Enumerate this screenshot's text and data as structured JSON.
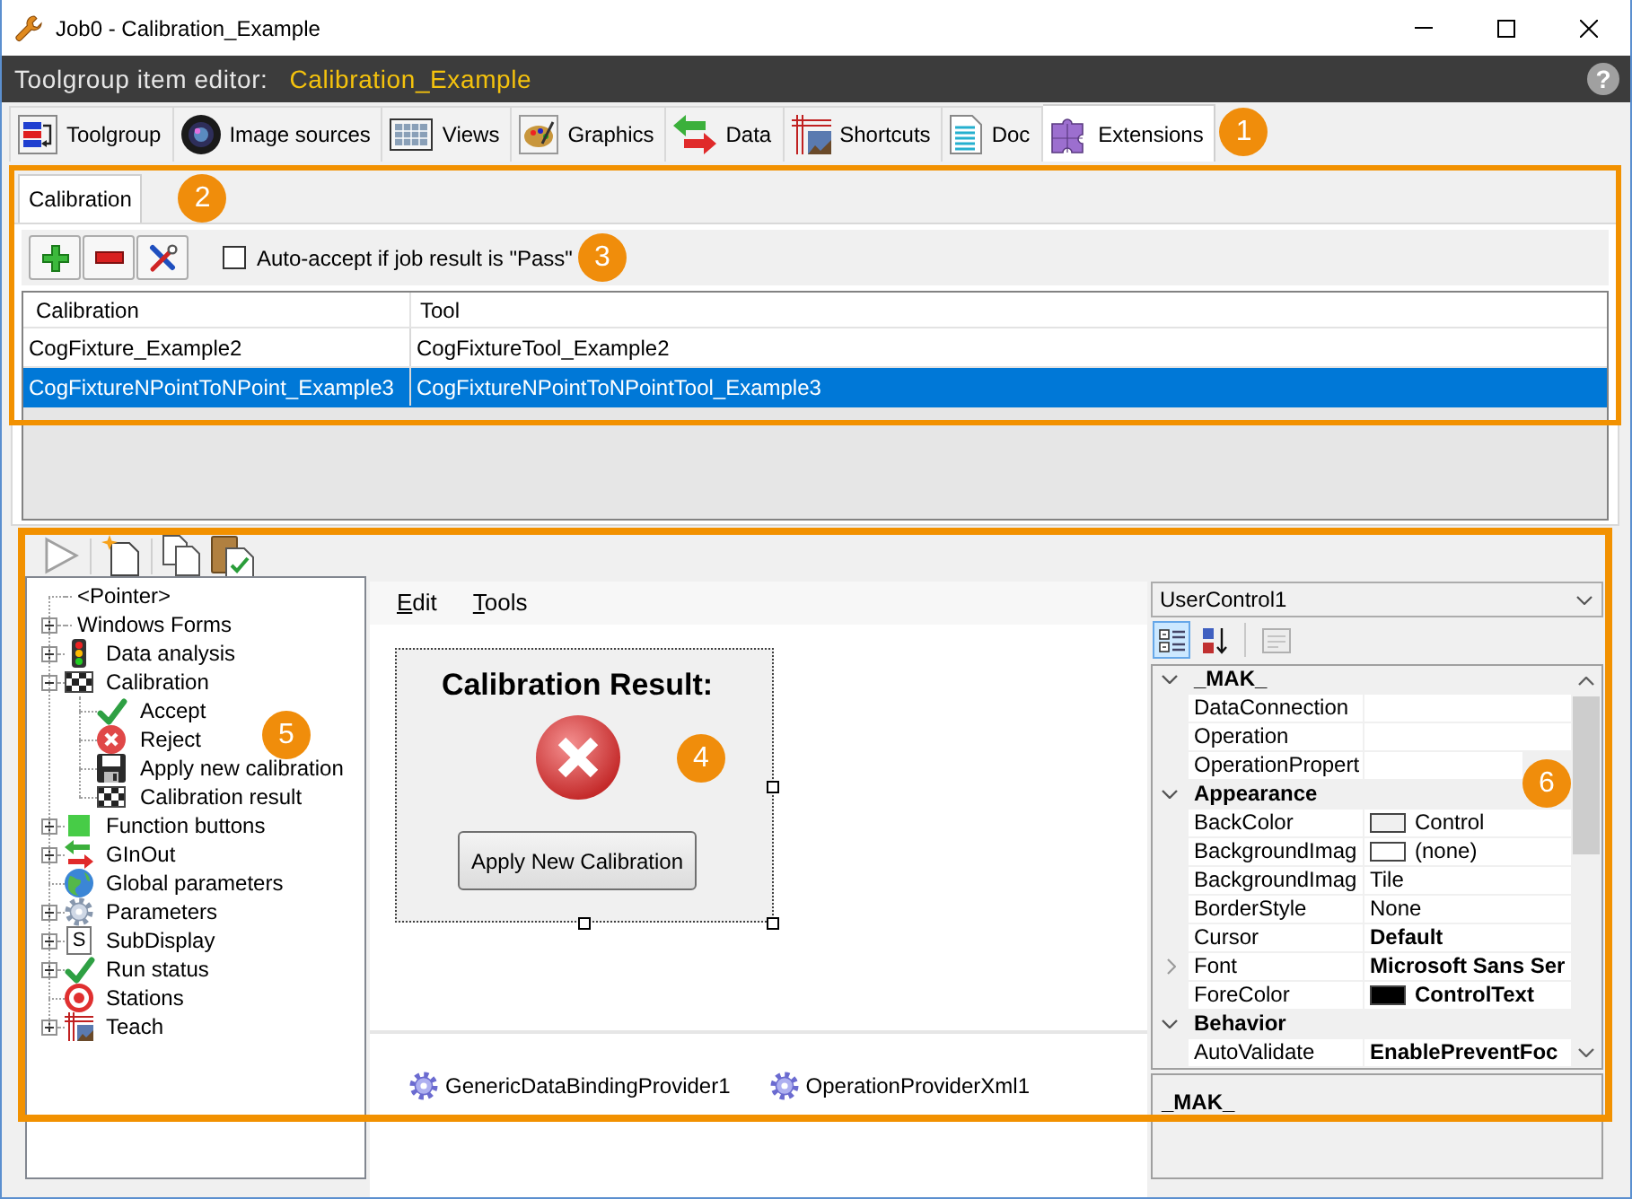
{
  "window": {
    "title": "Job0 - Calibration_Example"
  },
  "editor_header": {
    "label": "Toolgroup item editor:",
    "item_name": "Calibration_Example",
    "help": "?"
  },
  "main_tabs": {
    "items": [
      {
        "kind": "toolgroup",
        "label": "Toolgroup",
        "selected": false
      },
      {
        "kind": "image_sources",
        "label": "Image sources",
        "selected": false
      },
      {
        "kind": "views",
        "label": "Views",
        "selected": false
      },
      {
        "kind": "graphics",
        "label": "Graphics",
        "selected": false
      },
      {
        "kind": "data",
        "label": "Data",
        "selected": false
      },
      {
        "kind": "shortcuts",
        "label": "Shortcuts",
        "selected": false
      },
      {
        "kind": "doc",
        "label": "Doc",
        "selected": false
      },
      {
        "kind": "extensions",
        "label": "Extensions",
        "selected": true
      }
    ],
    "callout": "1"
  },
  "extension_tabs": {
    "items": [
      {
        "label": "Calibration",
        "selected": true
      }
    ],
    "callout": "2"
  },
  "auto_accept": {
    "label": "Auto-accept if job result is \"Pass\"",
    "checked": false,
    "callout": "3"
  },
  "calibration_table": {
    "columns": [
      "Calibration",
      "Tool"
    ],
    "rows": [
      {
        "cells": [
          "CogFixture_Example2",
          "CogFixtureTool_Example2"
        ],
        "selected": false
      },
      {
        "cells": [
          "CogFixtureNPointToNPoint_Example3",
          "CogFixtureNPointToNPointTool_Example3"
        ],
        "selected": true
      }
    ]
  },
  "toolbox": {
    "callout": "5",
    "items": [
      {
        "label": "<Pointer>"
      },
      {
        "label": "Windows Forms",
        "expanded": false
      },
      {
        "kind": "traffic_light",
        "label": "Data analysis",
        "expanded": false
      },
      {
        "kind": "checker",
        "label": "Calibration",
        "expanded": true,
        "children": [
          {
            "kind": "check",
            "label": "Accept"
          },
          {
            "kind": "error",
            "label": "Reject"
          },
          {
            "kind": "floppy",
            "label": "Apply new calibration"
          },
          {
            "kind": "checker",
            "label": "Calibration result"
          }
        ]
      },
      {
        "kind": "square",
        "label": "Function buttons",
        "expanded": false
      },
      {
        "kind": "arrows",
        "label": "GInOut",
        "expanded": false
      },
      {
        "kind": "globe",
        "label": "Global parameters"
      },
      {
        "kind": "gear",
        "label": "Parameters",
        "expanded": false
      },
      {
        "kind": "letter_box",
        "icon_text": "S",
        "label": "SubDisplay",
        "expanded": false
      },
      {
        "kind": "check",
        "label": "Run status",
        "expanded": false
      },
      {
        "kind": "target",
        "label": "Stations"
      },
      {
        "kind": "teach",
        "label": "Teach",
        "expanded": false
      }
    ]
  },
  "designer": {
    "menu": [
      {
        "label": "Edit",
        "mnemonic": true
      },
      {
        "label": "Tools",
        "mnemonic": true
      }
    ],
    "user_control": {
      "title": "Calibration Result:",
      "button": "Apply New Calibration",
      "selected": true,
      "callout": "4"
    },
    "components": [
      "GenericDataBindingProvider1",
      "OperationProviderXml1"
    ]
  },
  "properties": {
    "object": "UserControl1",
    "sort_modes": [
      {
        "kind": "categorized",
        "selected": true
      },
      {
        "kind": "alphabetical",
        "selected": false
      }
    ],
    "property_pages": {
      "disabled": true
    },
    "callout": "6",
    "categories": [
      {
        "name": "_MAK_",
        "expanded": true,
        "items": [
          {
            "kind": "text",
            "name": "DataConnection"
          },
          {
            "kind": "text",
            "name": "Operation"
          },
          {
            "kind": "text",
            "name": "OperationPropert"
          }
        ]
      },
      {
        "name": "Appearance",
        "expanded": true,
        "items": [
          {
            "kind": "color",
            "name": "BackColor",
            "value": "Control",
            "color": "#f0f0f0",
            "modified": false
          },
          {
            "kind": "image",
            "name": "BackgroundImag",
            "value": "(none)",
            "modified": false
          },
          {
            "kind": "text",
            "name": "BackgroundImag",
            "value": "Tile",
            "modified": false
          },
          {
            "kind": "text",
            "name": "BorderStyle",
            "value": "None",
            "modified": false
          },
          {
            "kind": "text",
            "name": "Cursor",
            "value": "Default",
            "modified": true
          },
          {
            "kind": "text",
            "name": "Font",
            "value": "Microsoft Sans Ser",
            "modified": true,
            "expanded": false
          },
          {
            "kind": "color",
            "name": "ForeColor",
            "value": "ControlText",
            "color": "#000000",
            "modified": true
          }
        ]
      },
      {
        "name": "Behavior",
        "expanded": true,
        "items": [
          {
            "kind": "text",
            "name": "AutoValidate",
            "value": "EnablePreventFoc",
            "modified": true
          }
        ]
      }
    ],
    "description": {
      "title": "_MAK_"
    }
  }
}
